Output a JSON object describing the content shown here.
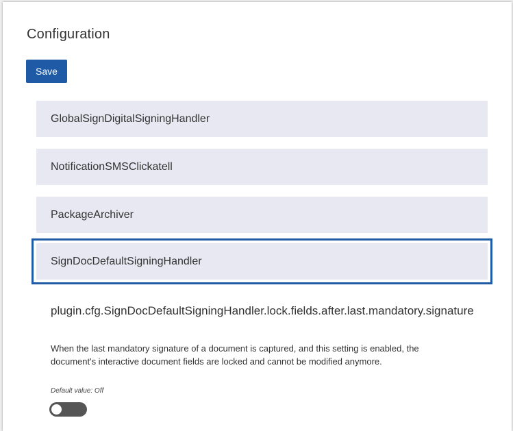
{
  "page": {
    "title": "Configuration"
  },
  "toolbar": {
    "save_label": "Save"
  },
  "plugins": [
    {
      "label": "GlobalSignDigitalSigningHandler",
      "selected": false
    },
    {
      "label": "NotificationSMSClickatell",
      "selected": false
    },
    {
      "label": "PackageArchiver",
      "selected": false
    },
    {
      "label": "SignDocDefaultSigningHandler",
      "selected": true
    }
  ],
  "setting": {
    "name": "plugin.cfg.SignDocDefaultSigningHandler.lock.fields.after.last.mandatory.signature",
    "description": "When the last mandatory signature of a document is captured, and this setting is enabled, the document's interactive document fields are locked and cannot be modified anymore.",
    "default_label": "Default value: Off",
    "toggle_value": "off"
  },
  "colors": {
    "accent": "#1f5aa6",
    "item_background": "#e8e8f3",
    "toggle_off": "#555555"
  }
}
